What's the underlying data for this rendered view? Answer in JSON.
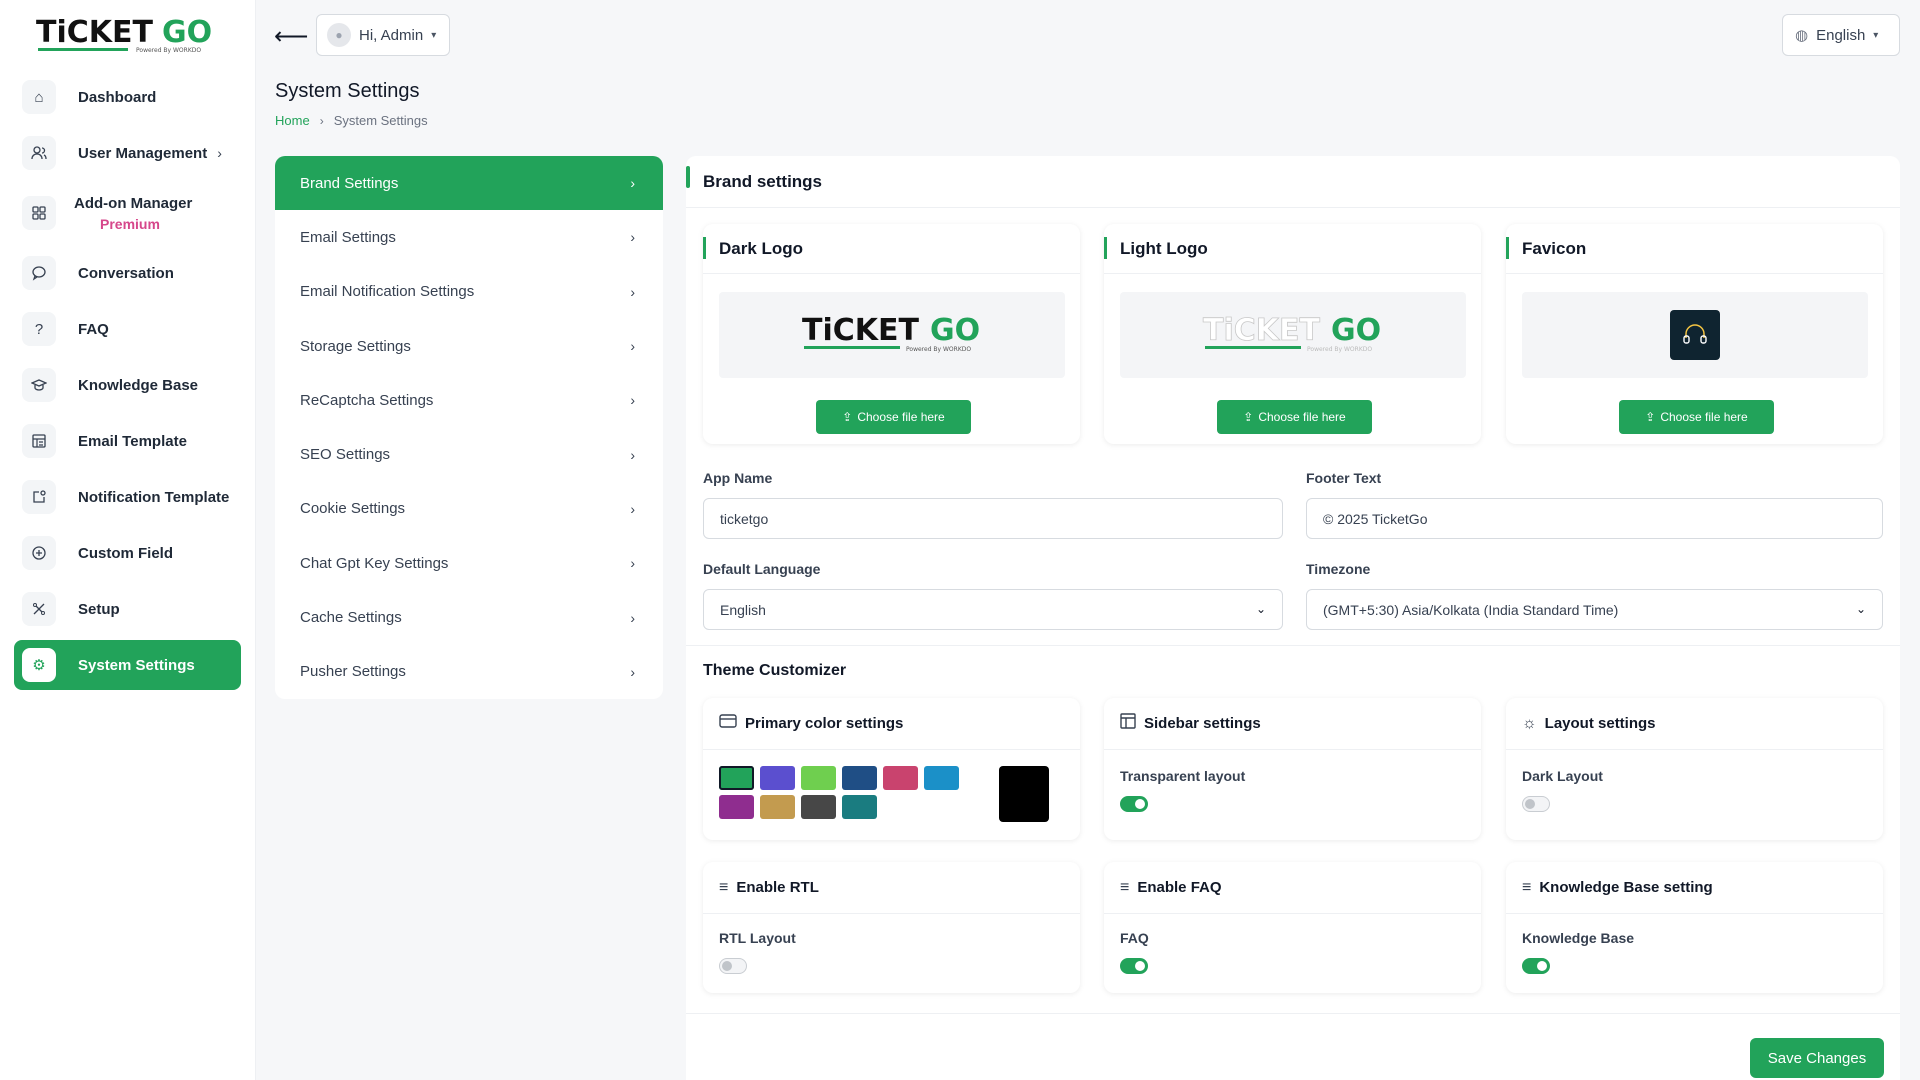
{
  "app": {
    "logo_text": "TiCKETGO",
    "logo_sub": "Powered By WORKDO"
  },
  "sidebar": {
    "items": [
      {
        "label": "Dashboard",
        "icon": "home-icon"
      },
      {
        "label": "User Management",
        "icon": "users-icon"
      },
      {
        "label": "Add-on Manager",
        "icon": "grid-icon",
        "badge": "Premium"
      },
      {
        "label": "Conversation",
        "icon": "chat-icon"
      },
      {
        "label": "FAQ",
        "icon": "question-icon"
      },
      {
        "label": "Knowledge Base",
        "icon": "graduation-cap-icon"
      },
      {
        "label": "Email Template",
        "icon": "template-icon"
      },
      {
        "label": "Notification Template",
        "icon": "notification-icon"
      },
      {
        "label": "Custom Field",
        "icon": "plus-circle-icon"
      },
      {
        "label": "Setup",
        "icon": "setup-icon"
      },
      {
        "label": "System Settings",
        "icon": "gear-icon"
      }
    ]
  },
  "topbar": {
    "user_greeting": "Hi, Admin",
    "language": "English"
  },
  "page": {
    "title": "System Settings",
    "breadcrumb_home": "Home",
    "breadcrumb_current": "System Settings"
  },
  "settings_menu": [
    "Brand Settings",
    "Email Settings",
    "Email Notification Settings",
    "Storage Settings",
    "ReCaptcha Settings",
    "SEO Settings",
    "Cookie Settings",
    "Chat Gpt Key Settings",
    "Cache Settings",
    "Pusher Settings"
  ],
  "brand": {
    "title": "Brand settings",
    "dark_logo": "Dark Logo",
    "light_logo": "Light Logo",
    "favicon": "Favicon",
    "choose_file": "Choose file here",
    "app_name_label": "App Name",
    "app_name_value": "ticketgo",
    "footer_text_label": "Footer Text",
    "footer_text_value": "© 2025 TicketGo",
    "default_language_label": "Default Language",
    "default_language_value": "English",
    "timezone_label": "Timezone",
    "timezone_value": "(GMT+5:30) Asia/Kolkata (India Standard Time)"
  },
  "theme": {
    "title": "Theme Customizer",
    "primary_color_title": "Primary color settings",
    "colors": [
      "#22a35a",
      "#5b4fcf",
      "#6fcf4f",
      "#1f4e85",
      "#c9436e",
      "#1b90c8",
      "#8f2d8f",
      "#c39b4f",
      "#474747",
      "#1a7c80"
    ],
    "selected_color": "#22a35a",
    "custom_color": "#000000",
    "sidebar_title": "Sidebar settings",
    "transparent_layout_label": "Transparent layout",
    "transparent_layout_on": true,
    "layout_title": "Layout settings",
    "dark_layout_label": "Dark Layout",
    "dark_layout_on": false,
    "rtl_title": "Enable RTL",
    "rtl_label": "RTL Layout",
    "rtl_on": false,
    "faq_title": "Enable FAQ",
    "faq_label": "FAQ",
    "faq_on": true,
    "kb_title": "Knowledge Base setting",
    "kb_label": "Knowledge Base",
    "kb_on": true
  },
  "actions": {
    "save": "Save Changes"
  }
}
